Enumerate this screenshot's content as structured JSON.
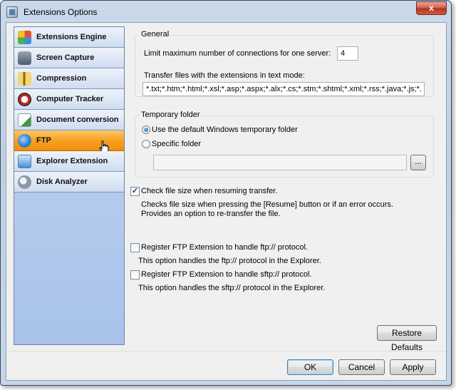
{
  "window": {
    "title": "Extensions Options",
    "close_label": "x"
  },
  "sidebar": {
    "items": [
      {
        "label": "Extensions Engine",
        "icon": "puzzle-icon",
        "color": "#e0523a"
      },
      {
        "label": "Screen Capture",
        "icon": "camera-icon",
        "color": "#5f6f80"
      },
      {
        "label": "Compression",
        "icon": "zip-folder-icon",
        "color": "#e8c04a"
      },
      {
        "label": "Computer Tracker",
        "icon": "tracker-icon",
        "color": "#c0281c"
      },
      {
        "label": "Document conversion",
        "icon": "document-icon",
        "color": "#3f9a3f"
      },
      {
        "label": "FTP",
        "icon": "ftp-globe-icon",
        "color": "#2f7fd0"
      },
      {
        "label": "Explorer Extension",
        "icon": "explorer-icon",
        "color": "#3c8fd8"
      },
      {
        "label": "Disk Analyzer",
        "icon": "disk-analyzer-icon",
        "color": "#8a97a6"
      }
    ],
    "active_index": 5
  },
  "general": {
    "title": "General",
    "max_connections_label": "Limit maximum number of connections for one server:",
    "max_connections_value": "4",
    "text_mode_label": "Transfer files with the extensions in text mode:",
    "text_mode_value": "*.txt;*.htm;*.html;*.xsl;*.asp;*.aspx;*.alx;*.cs;*.stm;*.shtml;*.xml;*.rss;*.java;*.js;*.cpp"
  },
  "temp_folder": {
    "title": "Temporary folder",
    "option_default": "Use the default Windows temporary folder",
    "option_specific": "Specific folder",
    "folder_value": "",
    "browse_label": "..."
  },
  "check_size": {
    "label": "Check file size when resuming transfer.",
    "checked": true,
    "description_1": "Checks file size when pressing the [Resume] button or if an error occurs.",
    "description_2": "Provides an option to re-transfer the file."
  },
  "register_ftp": {
    "label": "Register FTP Extension to handle ftp:// protocol.",
    "description": "This option handles the ftp:// protocol in the Explorer."
  },
  "register_sftp": {
    "label": "Register FTP Extension to handle sftp:// protocol.",
    "description": "This option handles the sftp:// protocol in the Explorer."
  },
  "buttons": {
    "restore_defaults": "Restore Defaults",
    "ok": "OK",
    "cancel": "Cancel",
    "apply": "Apply"
  }
}
